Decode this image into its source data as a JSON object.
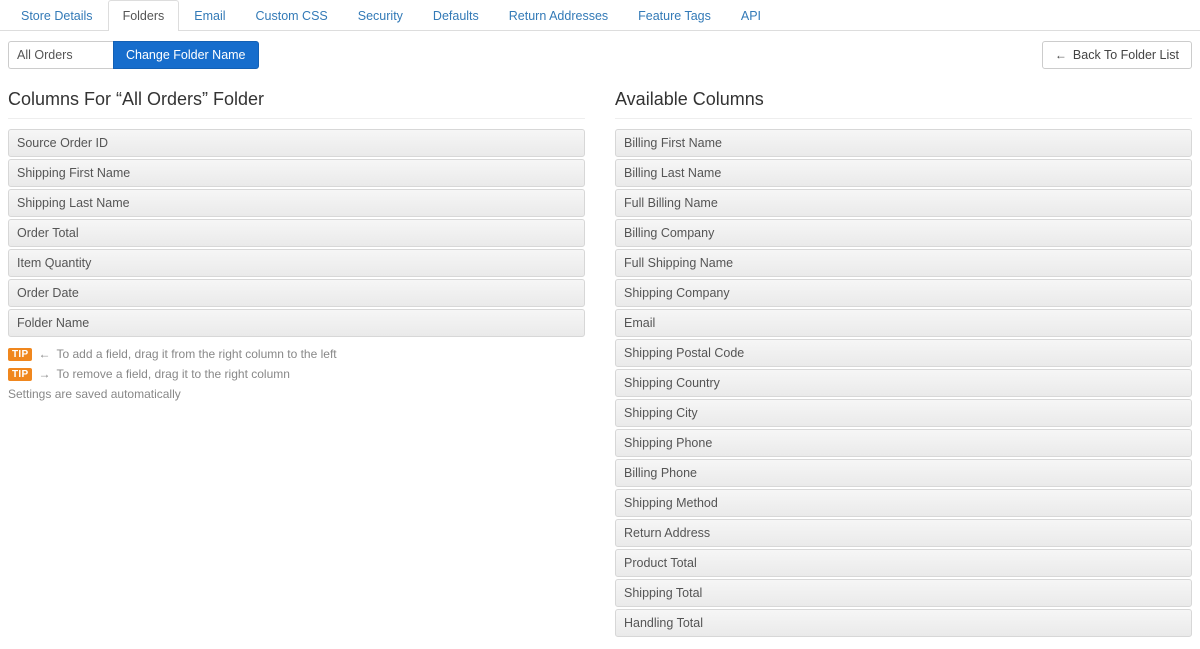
{
  "tabs": [
    {
      "label": "Store Details",
      "active": false
    },
    {
      "label": "Folders",
      "active": true
    },
    {
      "label": "Email",
      "active": false
    },
    {
      "label": "Custom CSS",
      "active": false
    },
    {
      "label": "Security",
      "active": false
    },
    {
      "label": "Defaults",
      "active": false
    },
    {
      "label": "Return Addresses",
      "active": false
    },
    {
      "label": "Feature Tags",
      "active": false
    },
    {
      "label": "API",
      "active": false
    }
  ],
  "toolbar": {
    "folder_name_value": "All Orders",
    "change_folder_label": "Change Folder Name",
    "back_label": "Back To Folder List"
  },
  "left": {
    "heading": "Columns For “All Orders” Folder",
    "fields": [
      "Source Order ID",
      "Shipping First Name",
      "Shipping Last Name",
      "Order Total",
      "Item Quantity",
      "Order Date",
      "Folder Name"
    ],
    "tip_badge": "TIP",
    "tip_add": "To add a field, drag it from the right column to the left",
    "tip_remove": "To remove a field, drag it to the right column",
    "auto_save": "Settings are saved automatically"
  },
  "right": {
    "heading": "Available Columns",
    "fields": [
      "Billing First Name",
      "Billing Last Name",
      "Full Billing Name",
      "Billing Company",
      "Full Shipping Name",
      "Shipping Company",
      "Email",
      "Shipping Postal Code",
      "Shipping Country",
      "Shipping City",
      "Shipping Phone",
      "Billing Phone",
      "Shipping Method",
      "Return Address",
      "Product Total",
      "Shipping Total",
      "Handling Total"
    ]
  }
}
